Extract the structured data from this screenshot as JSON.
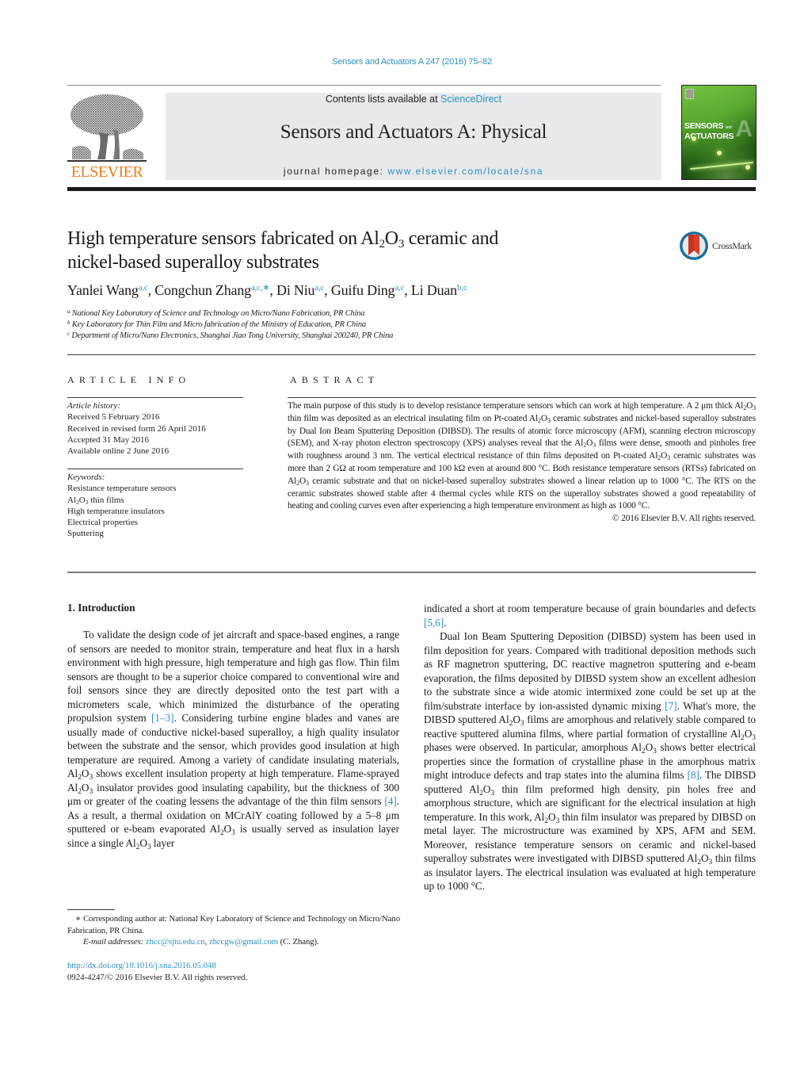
{
  "header": {
    "journal_ref": "Sensors and Actuators A 247 (2016) 75–82",
    "contents_prefix": "Contents lists available at ",
    "contents_link": "ScienceDirect",
    "journal_title": "Sensors and Actuators A: Physical",
    "homepage_prefix": "journal homepage: ",
    "homepage_link": "www.elsevier.com/locate/sna",
    "publisher_logo": "ELSEVIER",
    "cover_line1": "SENSORS",
    "cover_and": "and",
    "cover_line2": "ACTUATORS",
    "cover_letter": "A",
    "colors": {
      "link": "#2c8fbf",
      "elsevier_orange": "#f07c1a",
      "masthead_bg": "#e8e9eb",
      "cover_green": "#6cc53b"
    }
  },
  "article": {
    "title_part1": "High temperature sensors fabricated on Al",
    "title_sub1": "2",
    "title_part2": "O",
    "title_sub2": "3",
    "title_part3": " ceramic and",
    "title_line2": "nickel-based superalloy substrates",
    "crossmark_label": "CrossMark",
    "authors": [
      {
        "name": "Yanlei Wang",
        "affil": "a,c"
      },
      {
        "name": "Congchun Zhang",
        "affil": "a,c,∗"
      },
      {
        "name": "Di Niu",
        "affil": "a,c"
      },
      {
        "name": "Guifu Ding",
        "affil": "a,c"
      },
      {
        "name": "Li Duan",
        "affil": "b,c"
      }
    ],
    "affiliations": [
      {
        "key": "a",
        "text": "National Key Laboratory of Science and Technology on Micro/Nano Fabrication, PR China"
      },
      {
        "key": "b",
        "text": "Key Laboratory for Thin Film and Micro fabrication of the Ministry of Education, PR China"
      },
      {
        "key": "c",
        "text": "Department of Micro/Nano Electronics, Shanghai Jiao Tong University, Shanghai 200240, PR China"
      }
    ]
  },
  "article_info": {
    "heading": "ARTICLE INFO",
    "history_label": "Article history:",
    "history": [
      "Received 5 February 2016",
      "Received in revised form 26 April 2016",
      "Accepted 31 May 2016",
      "Available online 2 June 2016"
    ],
    "keywords_label": "Keywords:",
    "keyword1": "Resistance temperature sensors",
    "keyword2_pre": "Al",
    "keyword2_sub1": "2",
    "keyword2_mid": "O",
    "keyword2_sub2": "3",
    "keyword2_post": " thin films",
    "keyword3": "High temperature insulators",
    "keyword4": "Electrical properties",
    "keyword5": "Sputtering"
  },
  "abstract": {
    "heading": "ABSTRACT",
    "s1": "The main purpose of this study is to develop resistance temperature sensors which can work at high temperature. A 2 μm thick Al",
    "s2": " thin film was deposited as an electrical insulating film on Pt-coated Al",
    "s3": " ceramic substrates and nickel-based superalloy substrates by Dual Ion Beam Sputtering Deposition (DIBSD). The results of atomic force microscopy (AFM), scanning electron microscopy (SEM), and X-ray photon electron spectroscopy (XPS) analyses reveal that the Al",
    "s4": " films were dense, smooth and pinholes free with roughness around 3 nm. The vertical electrical resistance of thin films deposited on Pt-coated Al",
    "s5": " ceramic substrates was more than 2 GΩ at room temperature and 100 kΩ even at around 800 °C. Both resistance temperature sensors (RTSs) fabricated on Al",
    "s6": " ceramic substrate and that on nickel-based superalloy substrates showed a linear relation up to 1000 °C. The RTS on the ceramic substrates showed stable after 4 thermal cycles while RTS on the superalloy substrates showed a good repeatability of heating and cooling curves even after experiencing a high temperature environment as high as 1000 °C.",
    "copyright": "© 2016 Elsevier B.V. All rights reserved."
  },
  "formula": {
    "sub2": "2",
    "o": "O",
    "sub3": "3"
  },
  "intro": {
    "heading": "1.  Introduction",
    "p1_a": "To validate the design code of jet aircraft and space-based engines, a range of sensors are needed to monitor strain, temperature and heat flux in a harsh environment with high pressure, high temperature and high gas flow. Thin film sensors are thought to be a superior choice compared to conventional wire and foil sensors since they are directly deposited onto the test part with a micrometers scale, which minimized the disturbance of the operating propulsion system ",
    "ref_1_3": "[1–3]",
    "p1_b": ". Considering turbine engine blades and vanes are usually made of conductive nickel-based superalloy, a high quality insulator between the substrate and the sensor, which provides good insulation at high temperature are required. Among a variety of candidate insulating materials, Al",
    "p1_c": " shows excellent insulation property at high temperature. Flame-sprayed Al",
    "p1_d": " insulator provides good insulating capability, but the thickness of 300 μm or greater of the coating lessens the advantage of the thin film sensors ",
    "ref_4": "[4]",
    "p1_e": ". As a result, a thermal oxidation on MCrAlY coating followed by a 5–8 μm sputtered or e-beam evaporated Al",
    "p1_f": " is usually served as insulation layer since a single Al",
    "p1_g": " layer",
    "c2_a": "indicated a short at room temperature because of grain boundaries and defects ",
    "ref_5_6": "[5,6]",
    "c2_b": ".",
    "p2_a": "Dual Ion Beam Sputtering Deposition (DIBSD) system has been used in film deposition for years. Compared with traditional deposition methods such as RF magnetron sputtering, DC reactive magnetron sputtering and e-beam evaporation, the films deposited by DIBSD system show an excellent adhesion to the substrate since a wide atomic intermixed zone could be set up at the film/substrate interface by ion-assisted dynamic mixing ",
    "ref_7": "[7]",
    "p2_b": ". What's more, the DIBSD sputtered Al",
    "p2_c": " films are amorphous and relatively stable compared to reactive sputtered alumina films, where partial formation of crystalline Al",
    "p2_d": " phases were observed. In particular, amorphous Al",
    "p2_e": " shows better electrical properties since the formation of crystalline phase in the amorphous matrix might introduce defects and trap states into the alumina films ",
    "ref_8": "[8]",
    "p2_f": ". The DIBSD sputtered Al",
    "p2_g": " thin film preformed high density, pin holes free and amorphous structure, which are significant for the electrical insulation at high temperature. In this work, Al",
    "p2_h": " thin film insulator was prepared by DIBSD on metal layer. The microstructure was examined by XPS, AFM and SEM. Moreover, resistance temperature sensors on ceramic and nickel-based superalloy substrates were investigated with DIBSD sputtered Al",
    "p2_i": " thin films as insulator layers. The electrical insulation was evaluated at high temperature up to 1000 °C."
  },
  "footnotes": {
    "corresponding": "∗  Corresponding author at: National Key Laboratory of Science and Technology on Micro/Nano Fabrication, PR China.",
    "email_label": "E-mail addresses: ",
    "email1": "zhcc@sjtu.edu.cn",
    "email_sep": ", ",
    "email2": "zhccgw@gmail.com",
    "email_owner": " (C. Zhang).",
    "doi": "http://dx.doi.org/10.1016/j.sna.2016.05.048",
    "issn_copyright": "0924-4247/© 2016 Elsevier B.V. All rights reserved."
  }
}
